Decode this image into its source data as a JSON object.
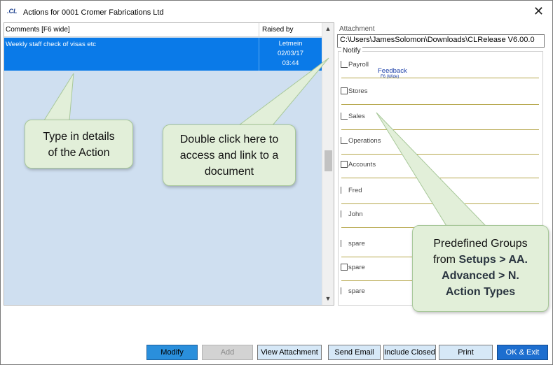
{
  "window": {
    "app_logo": ".CL",
    "title": "Actions for  0001 Cromer Fabrications Ltd",
    "close_symbol": "✕"
  },
  "comments": {
    "header_comments": "Comments [F6 wide]",
    "header_raised_by": "Raised by",
    "rows": [
      {
        "comment": "Weekly staff check of visas etc",
        "raised_by": "Letmein",
        "date": "02/03/17",
        "time": "03:44"
      }
    ],
    "scroll_up_symbol": "▲",
    "scroll_down_symbol": "▼",
    "selected_row_color": "#0a7ae8",
    "background_color": "#cfdff0"
  },
  "attachment": {
    "label": "Attachment",
    "value": "C:\\Users\\JamesSolomon\\Downloads\\CLRelease V6.00.0"
  },
  "notify": {
    "label": "Notify",
    "feedback_label": "Feedback",
    "feedback_sub": "F6 (Wide)",
    "items": [
      {
        "label": "Payroll",
        "checked": true
      },
      {
        "label": "Stores",
        "checked": true
      },
      {
        "label": "Sales",
        "checked": true
      },
      {
        "label": "Operations",
        "checked": true
      },
      {
        "label": "Accounts",
        "checked": true
      },
      {
        "label": "Fred",
        "checked": false
      },
      {
        "label": "John",
        "checked": false
      },
      {
        "label": "spare",
        "checked": false
      },
      {
        "label": "spare",
        "checked": false
      },
      {
        "label": "spare",
        "checked": false
      }
    ]
  },
  "callouts": {
    "type_details": {
      "line1": "Type in details",
      "line2": "of the Action"
    },
    "double_click": {
      "line1": "Double click here to",
      "line2": "access and link to a",
      "line3": "document"
    },
    "predefined": {
      "line1": "Predefined Groups",
      "line2_prefix": "from ",
      "line2_bold": "Setups > AA.",
      "line3": "Advanced > N.",
      "line4": "Action Types"
    },
    "color": "#e2efd9"
  },
  "buttons": {
    "modify": "Modify",
    "add": "Add",
    "view_attachment": "View Attachment",
    "send_email": "Send Email",
    "include_closed": "Include Closed",
    "print": "Print",
    "ok_exit": "OK & Exit"
  },
  "colors": {
    "accent": "#1d6ecf",
    "button_bg": "#d6e8f7",
    "notify_line": "#b5a64a"
  }
}
